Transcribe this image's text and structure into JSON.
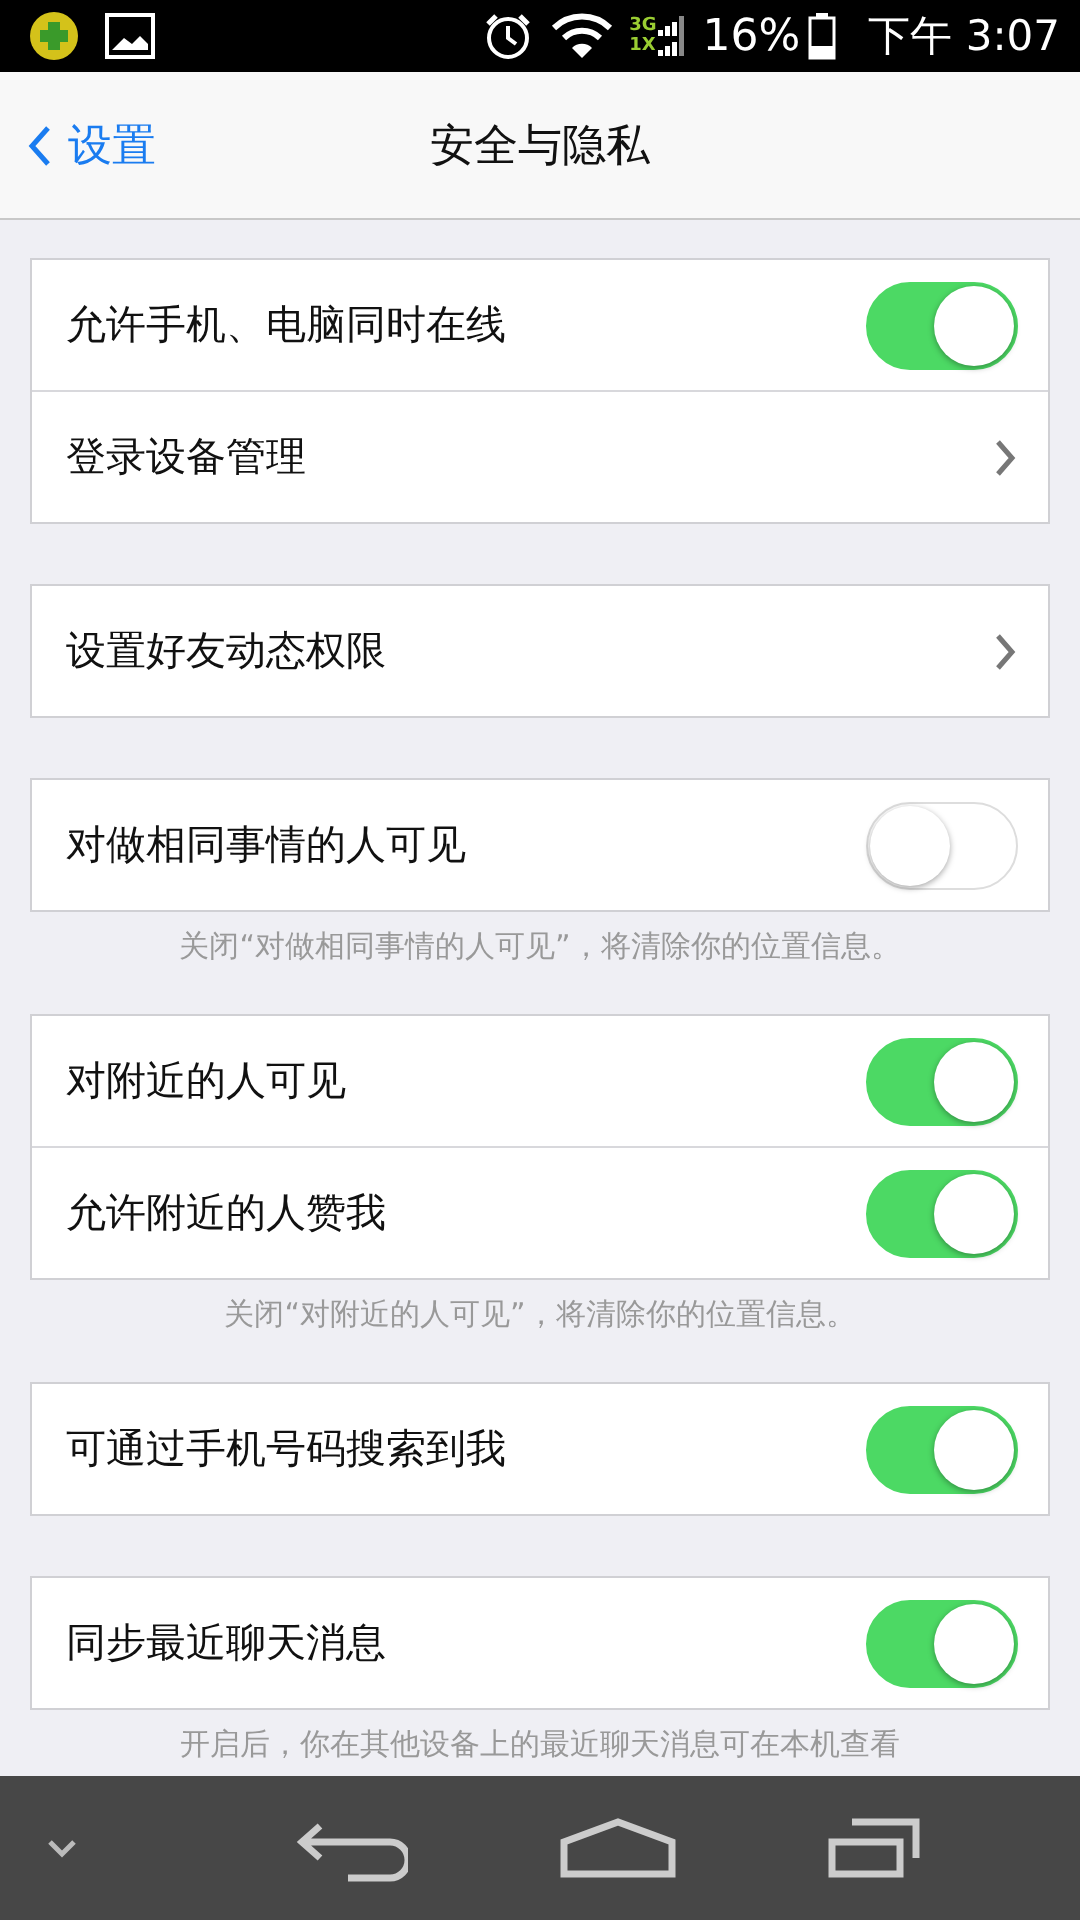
{
  "status_bar": {
    "battery": "16%",
    "time": "下午 3:07",
    "network": [
      "3G",
      "1X"
    ]
  },
  "nav_bar": {
    "back": "设置",
    "title": "安全与隐私"
  },
  "groups": [
    {
      "rows": [
        {
          "kind": "toggle",
          "label": "允许手机、电脑同时在线",
          "on": true
        },
        {
          "kind": "link",
          "label": "登录设备管理"
        }
      ]
    },
    {
      "rows": [
        {
          "kind": "link",
          "label": "设置好友动态权限"
        }
      ]
    },
    {
      "rows": [
        {
          "kind": "toggle",
          "label": "对做相同事情的人可见",
          "on": false
        }
      ],
      "note": "关闭“对做相同事情的人可见”，将清除你的位置信息。"
    },
    {
      "rows": [
        {
          "kind": "toggle",
          "label": "对附近的人可见",
          "on": true
        },
        {
          "kind": "toggle",
          "label": "允许附近的人赞我",
          "on": true
        }
      ],
      "note": "关闭“对附近的人可见”，将清除你的位置信息。"
    },
    {
      "rows": [
        {
          "kind": "toggle",
          "label": "可通过手机号码搜索到我",
          "on": true
        }
      ]
    },
    {
      "rows": [
        {
          "kind": "toggle",
          "label": "同步最近聊天消息",
          "on": true
        }
      ],
      "note": "开启后，你在其他设备上的最近聊天消息可在本机查看"
    }
  ]
}
